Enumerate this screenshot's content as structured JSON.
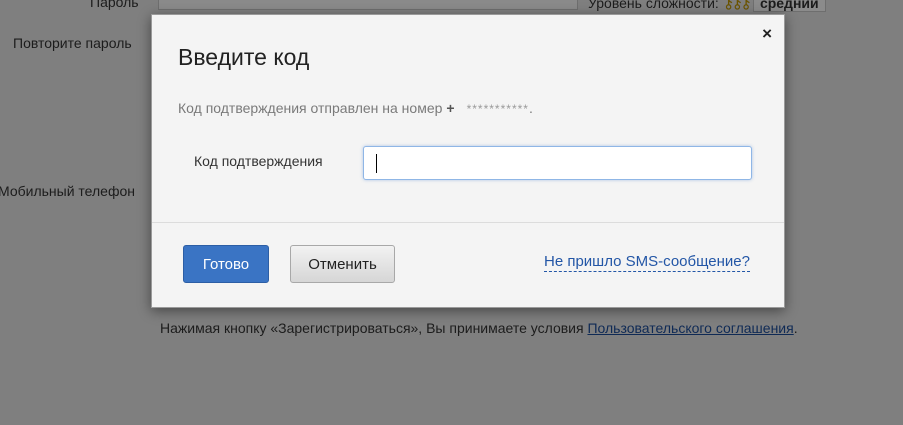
{
  "background": {
    "password_label": "Пароль",
    "repeat_password_label": "Повторите пароль",
    "phone_label": "Мобильный телефон",
    "strength_label": "Уровень сложности:",
    "strength_value": "средний",
    "terms_text": "Нажимая кнопку «Зарегистрироваться», Вы принимаете условия ",
    "terms_link": "Пользовательского соглашения",
    "terms_end": "."
  },
  "modal": {
    "title": "Введите код",
    "close": "×",
    "notice_text": "Код подтверждения отправлен на номер",
    "notice_plus": "+",
    "notice_number": "***********",
    "notice_end": ".",
    "code_label": "Код подтверждения",
    "code_value": "",
    "done_button": "Готово",
    "cancel_button": "Отменить",
    "sms_link": "Не пришло SMS-сообщение?"
  },
  "colors": {
    "primary_button": "#3a74c4",
    "link": "#2356a6",
    "overlay": "#7f7f7f"
  }
}
